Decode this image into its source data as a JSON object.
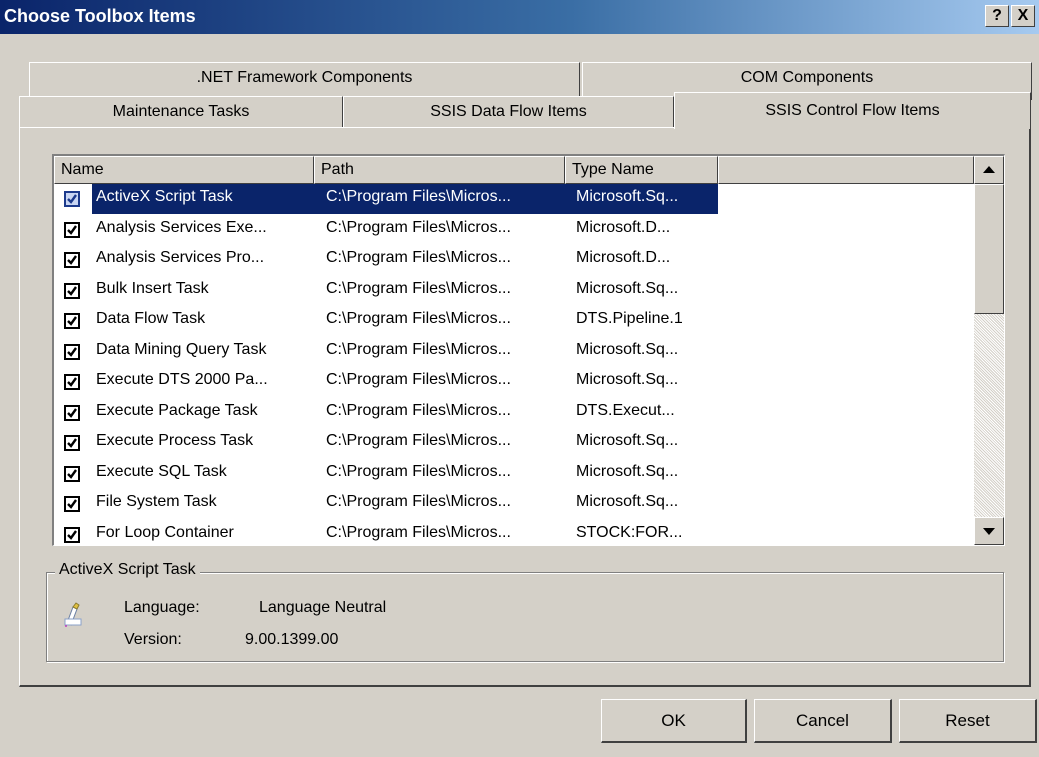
{
  "window": {
    "title": "Choose Toolbox Items",
    "help_button": "?",
    "close_button": "X"
  },
  "tabs": {
    "row_back": [
      ".NET Framework Components",
      "COM Components"
    ],
    "row_front": [
      "Maintenance Tasks",
      "SSIS Data Flow Items",
      "SSIS Control Flow Items"
    ],
    "active": "SSIS Control Flow Items"
  },
  "list": {
    "columns": [
      "Name",
      "Path",
      "Type Name",
      ""
    ],
    "rows": [
      {
        "checked": true,
        "selected": true,
        "name": "ActiveX Script Task",
        "path": "C:\\Program Files\\Micros...",
        "type": "Microsoft.Sq..."
      },
      {
        "checked": true,
        "selected": false,
        "name": "Analysis Services Exe...",
        "path": "C:\\Program Files\\Micros...",
        "type": "Microsoft.D..."
      },
      {
        "checked": true,
        "selected": false,
        "name": "Analysis Services Pro...",
        "path": "C:\\Program Files\\Micros...",
        "type": "Microsoft.D..."
      },
      {
        "checked": true,
        "selected": false,
        "name": "Bulk Insert Task",
        "path": "C:\\Program Files\\Micros...",
        "type": "Microsoft.Sq..."
      },
      {
        "checked": true,
        "selected": false,
        "name": "Data Flow Task",
        "path": "C:\\Program Files\\Micros...",
        "type": "DTS.Pipeline.1"
      },
      {
        "checked": true,
        "selected": false,
        "name": "Data Mining Query Task",
        "path": "C:\\Program Files\\Micros...",
        "type": "Microsoft.Sq..."
      },
      {
        "checked": true,
        "selected": false,
        "name": "Execute DTS 2000 Pa...",
        "path": "C:\\Program Files\\Micros...",
        "type": "Microsoft.Sq..."
      },
      {
        "checked": true,
        "selected": false,
        "name": "Execute Package Task",
        "path": "C:\\Program Files\\Micros...",
        "type": "DTS.Execut..."
      },
      {
        "checked": true,
        "selected": false,
        "name": "Execute Process Task",
        "path": "C:\\Program Files\\Micros...",
        "type": "Microsoft.Sq..."
      },
      {
        "checked": true,
        "selected": false,
        "name": "Execute SQL Task",
        "path": "C:\\Program Files\\Micros...",
        "type": "Microsoft.Sq..."
      },
      {
        "checked": true,
        "selected": false,
        "name": "File System Task",
        "path": "C:\\Program Files\\Micros...",
        "type": "Microsoft.Sq..."
      },
      {
        "checked": true,
        "selected": false,
        "name": "For Loop Container",
        "path": "C:\\Program Files\\Micros...",
        "type": "STOCK:FOR..."
      }
    ]
  },
  "details": {
    "group_title": "ActiveX Script Task",
    "language_label": "Language:",
    "language_value": "Language Neutral",
    "version_label": "Version:",
    "version_value": "9.00.1399.00",
    "icon": "script-task-icon"
  },
  "buttons": {
    "ok": "OK",
    "cancel": "Cancel",
    "reset": "Reset"
  },
  "colors": {
    "titlebar_start": "#0a246a",
    "titlebar_end": "#a6caf0",
    "selection": "#0a246a",
    "face": "#d4d0c8"
  }
}
